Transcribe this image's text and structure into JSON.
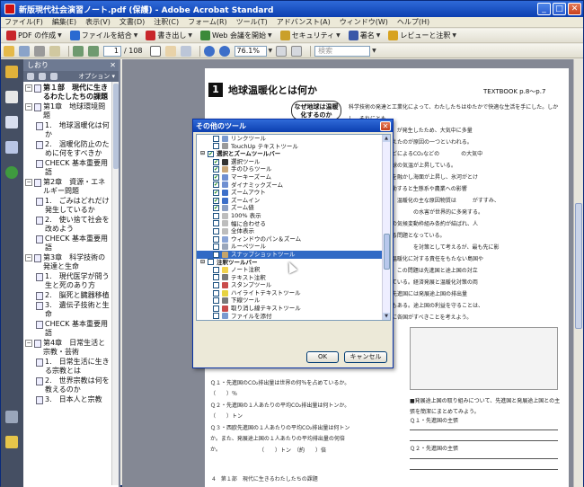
{
  "window": {
    "title": "新版現代社会演習ノート.pdf (保護) - Adobe Acrobat Standard",
    "min_btn": "_",
    "max_btn": "□",
    "close_btn": "✕"
  },
  "menu": [
    "ファイル(F)",
    "編集(E)",
    "表示(V)",
    "文書(D)",
    "注釈(C)",
    "フォーム(R)",
    "ツール(T)",
    "アドバンスト(A)",
    "ウィンドウ(W)",
    "ヘルプ(H)"
  ],
  "toolbar1": [
    {
      "label": "PDF の作成",
      "color": "#c8262b"
    },
    {
      "label": "ファイルを結合",
      "color": "#2a6ad1"
    },
    {
      "label": "書き出し",
      "color": "#c8262b"
    },
    {
      "label": "Web 会議を開始",
      "color": "#3b8a3a"
    },
    {
      "label": "セキュリティ",
      "color": "#caa02a"
    },
    {
      "label": "署名",
      "color": "#3a57a8"
    },
    {
      "label": "レビューと注釈",
      "color": "#d7a21f"
    }
  ],
  "toolbar2": {
    "page_current": "1",
    "page_total": "/ 108",
    "zoom": "76.1%",
    "search_placeholder": "検索"
  },
  "bookmarks": {
    "header": "しおり",
    "close": "✕",
    "options": "オプション ▾",
    "items": [
      {
        "level": 0,
        "toggle": "−",
        "text": "第１部　現代に生きるわたしたちの課題"
      },
      {
        "level": 1,
        "toggle": "−",
        "text": "第1章　地球環境問題"
      },
      {
        "level": 2,
        "toggle": "",
        "text": "1.　地球温暖化は何か"
      },
      {
        "level": 2,
        "toggle": "",
        "text": "2.　温暖化防止のために何をすべきか"
      },
      {
        "level": 2,
        "toggle": "",
        "text": "CHECK 基本重要用語"
      },
      {
        "level": 1,
        "toggle": "−",
        "text": "第2章　資源・エネルギー問題"
      },
      {
        "level": 2,
        "toggle": "",
        "text": "1.　ごみはどれだけ発生しているか"
      },
      {
        "level": 2,
        "toggle": "",
        "text": "2.　使い捨て社会を改めよう"
      },
      {
        "level": 2,
        "toggle": "",
        "text": "CHECK 基本重要用語"
      },
      {
        "level": 1,
        "toggle": "−",
        "text": "第3章　科学技術の発達と生命"
      },
      {
        "level": 2,
        "toggle": "",
        "text": "1.　現代医学が問う生と死のあり方"
      },
      {
        "level": 2,
        "toggle": "",
        "text": "2.　脳死と臓器移植"
      },
      {
        "level": 2,
        "toggle": "",
        "text": "3.　遺伝子技術と生命"
      },
      {
        "level": 2,
        "toggle": "",
        "text": "CHECK 基本重要用語"
      },
      {
        "level": 1,
        "toggle": "−",
        "text": "第4章　日常生活と宗教・芸術"
      },
      {
        "level": 2,
        "toggle": "",
        "text": "1.　日常生活に生きる宗教とは"
      },
      {
        "level": 2,
        "toggle": "",
        "text": "2.　世界宗教は何を教えるのか"
      },
      {
        "level": 2,
        "toggle": "",
        "text": "3.　日本人と宗教"
      }
    ]
  },
  "document": {
    "chapter_num": "1",
    "chapter_title": "地球温暖化とは何か",
    "textbook_ref": "TEXTBOOK p.8〜p.7",
    "side_question": "なぜ地球は温暖化するのか",
    "q1": "Ｑ１・先進国のCO₂排出量は世界の何％を占めているか。　　（　　）％",
    "q2": "Ｑ２・先進国の１人あたりの平均CO₂排出量は何トンか。　　（　　）トン",
    "q3": "Ｑ３・西欧先進国の１人あたりの平均CO₂排出量は何トンか。また、発展途上国の１人あたりの平均排出量の何倍か。",
    "q3_blank": "（　　）トン　（約　　）倍",
    "right_caption": "■発展途上国の取り組みについて、先進国と発展途上国との主張を簡潔にまとめてみよう。",
    "right_q1": "Ｑ１・先進国の主張",
    "right_q2": "Ｑ２・先進国の主張",
    "footer": "4　第１部　現代に生きるわたしたちの課題",
    "body_lines": [
      "科学技術の発達と工業化によって、わたしたちはゆたかで快適な生活を手にした。しかし、それにとも",
      "なって　　　　　　が発生したため、大気中に多量",
      "の二酸化炭素が増えたのが原因の一つといわれる。",
      "化石燃料の燃焼などによるCO₂などの　　　　の大気中",
      "の濃度が高まり地球の気温が上昇している。",
      "　　　　　が雪氷を融かし海面が上昇し、氷河がとけ",
      "るなど、気候が変動すると生態系や農業への影響",
      "が懸念されている。温暖化の主な原因物質は　　　がすすみ、",
      "　　　　　　　　　　　　の水害が世界的に多発する。",
      "　　　　　　　　の気候変動枠組み条約が結ばれ、人",
      "類の生存にかかわる問題となっている。",
      "　　　　　　　　　　　　を対策として考えるが、最も先に影",
      "響を受けるのは、温暖化に対する責任をもたない島国や",
      "開発途上国であり、この問題は先進国と途上国の対立",
      "の構図を生みだしている。経済発展と温暖化対策の両",
      "立が課題である。先進国には発展途上国の排出量",
      "の抑制を求める声もある。途上国の利益を守ることは、",
      "温暖化防止のために各国がすべきことを考えよう。"
    ]
  },
  "dialog": {
    "title": "その他のツール",
    "close": "✕",
    "ok": "OK",
    "cancel": "キャンセル",
    "rows": [
      {
        "type": "item",
        "checked": false,
        "icon": "#7a9ad0",
        "label": "リンクツール"
      },
      {
        "type": "item",
        "checked": false,
        "icon": "#9a9a9a",
        "label": "TouchUp テキストツール"
      },
      {
        "type": "group",
        "checked": true,
        "label": "選択とズームツールバー"
      },
      {
        "type": "item",
        "checked": true,
        "icon": "#333333",
        "label": "選択ツール"
      },
      {
        "type": "item",
        "checked": true,
        "icon": "#c9a77a",
        "label": "手のひらツール"
      },
      {
        "type": "item",
        "checked": true,
        "icon": "#6f8fd1",
        "label": "マーキーズーム"
      },
      {
        "type": "item",
        "checked": true,
        "icon": "#6f8fd1",
        "label": "ダイナミックズーム"
      },
      {
        "type": "item",
        "checked": true,
        "icon": "#3d6fc9",
        "label": "ズームアウト"
      },
      {
        "type": "item",
        "checked": true,
        "icon": "#3d6fc9",
        "label": "ズームイン"
      },
      {
        "type": "item",
        "checked": true,
        "icon": "#8da0c4",
        "label": "ズーム値"
      },
      {
        "type": "item",
        "checked": false,
        "icon": "#bdbdbd",
        "label": "100% 表示"
      },
      {
        "type": "item",
        "checked": false,
        "icon": "#bdbdbd",
        "label": "幅に合わせる"
      },
      {
        "type": "item",
        "checked": false,
        "icon": "#bdbdbd",
        "label": "全体表示"
      },
      {
        "type": "item",
        "checked": false,
        "icon": "#8aa4d6",
        "label": "ウィンドウのパン＆ズーム"
      },
      {
        "type": "item",
        "checked": false,
        "icon": "#9aa6bb",
        "label": "ルーペツール"
      },
      {
        "type": "item",
        "checked": false,
        "icon": "#c5a46b",
        "label": "スナップショットツール",
        "selected": true
      },
      {
        "type": "group",
        "checked": false,
        "label": "注釈ツールバー"
      },
      {
        "type": "item",
        "checked": false,
        "icon": "#f2d34e",
        "label": "ノート注釈"
      },
      {
        "type": "item",
        "checked": false,
        "icon": "#7a7a7a",
        "label": "テキスト注釈"
      },
      {
        "type": "item",
        "checked": false,
        "icon": "#c94b4b",
        "label": "スタンプツール"
      },
      {
        "type": "item",
        "checked": false,
        "icon": "#e7d341",
        "label": "ハイライトテキストツール"
      },
      {
        "type": "item",
        "checked": false,
        "icon": "#7a7a7a",
        "label": "下線ツール"
      },
      {
        "type": "item",
        "checked": false,
        "icon": "#c94b4b",
        "label": "取り消し線テキストツール"
      },
      {
        "type": "item",
        "checked": false,
        "icon": "#7a9ad0",
        "label": "ファイルを添付"
      }
    ]
  }
}
